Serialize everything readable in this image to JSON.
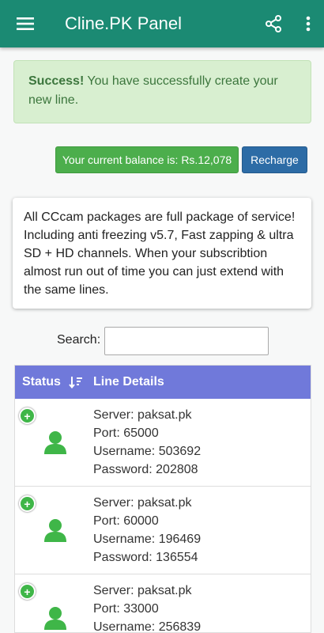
{
  "appbar": {
    "title": "Cline.PK Panel",
    "menu_icon": "hamburger-menu-icon",
    "share_icon": "share-icon",
    "more_icon": "more-vertical-icon"
  },
  "alert": {
    "strong": "Success!",
    "message": " You have successfully create your new line."
  },
  "balance": {
    "text": "Your current balance is: Rs.12,078",
    "recharge_label": "Recharge"
  },
  "info": {
    "text": "All CCcam packages are full package of service! Including anti freezing v5.7, Fast zapping & ultra SD + HD channels. When your subscribtion almost run out of time you can just extend with the same lines."
  },
  "search": {
    "label": "Search:",
    "value": ""
  },
  "table": {
    "headers": {
      "status": "Status",
      "details": "Line Details"
    },
    "rows": [
      {
        "server": "Server: paksat.pk",
        "port": "Port: 65000",
        "username": "Username: 503692",
        "password": "Password: 202808"
      },
      {
        "server": "Server: paksat.pk",
        "port": "Port: 60000",
        "username": "Username: 196469",
        "password": "Password: 136554"
      },
      {
        "server": "Server: paksat.pk",
        "port": "Port: 33000",
        "username": "Username: 256839",
        "password": ""
      }
    ]
  },
  "colors": {
    "appbar": "#1b8a73",
    "success_bg": "#d8efd0",
    "balance_btn": "#4cae4c",
    "recharge_btn": "#2d6ca6",
    "table_header": "#7079da",
    "status_icon": "#3fb648"
  }
}
